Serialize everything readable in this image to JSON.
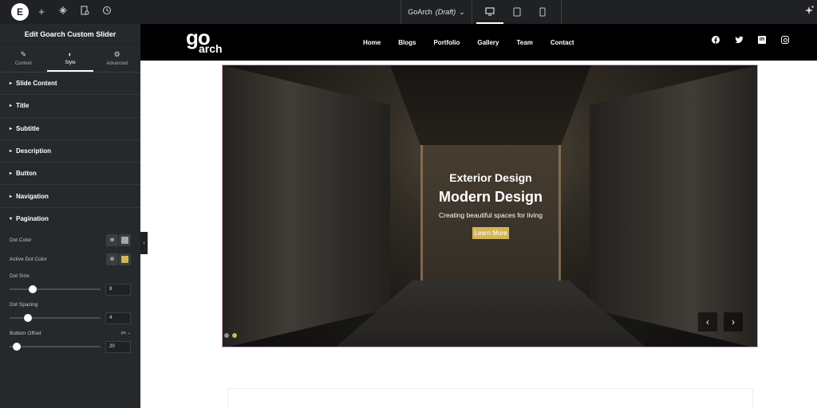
{
  "topbar": {
    "logo_letter": "E",
    "add_icon": "+",
    "doc_name": "GoArch",
    "doc_status": "(Draft)",
    "chevron": "⌄",
    "devices": [
      "desktop-icon",
      "tablet-icon",
      "mobile-icon"
    ]
  },
  "sidebar": {
    "header": "Edit Goarch Custom Slider",
    "tabs": [
      {
        "label": "Content",
        "icon": "✎"
      },
      {
        "label": "Style",
        "icon": "◐"
      },
      {
        "label": "Advanced",
        "icon": "⚙"
      }
    ],
    "sections": [
      "Slide Content",
      "Title",
      "Subtitle",
      "Description",
      "Button",
      "Navigation",
      "Pagination"
    ],
    "caret_collapsed": "▸",
    "caret_open": "▾",
    "dot_color_label": "Dot Color",
    "active_dot_color_label": "Active Dot Color",
    "dot_size_label": "Dot Size",
    "dot_size_value": "8",
    "dot_size_fraction": 0.25,
    "dot_spacing_label": "Dot Spacing",
    "dot_spacing_value": "4",
    "dot_spacing_fraction": 0.2,
    "bottom_offset_label": "Bottom Offset",
    "bottom_offset_unit": "px ⌄",
    "bottom_offset_value": "20",
    "bottom_offset_fraction": 0.08,
    "globe_icon": "⊕",
    "collapse_icon": "‹"
  },
  "site": {
    "brand_top": "go",
    "brand_bottom": "arch",
    "nav": [
      "Home",
      "Blogs",
      "Portfolio",
      "Gallery",
      "Team",
      "Contact"
    ],
    "social": [
      "facebook-icon",
      "twitter-icon",
      "linkedin-icon",
      "instagram-icon"
    ],
    "linkedin_text": "in"
  },
  "slide": {
    "title": "Exterior Design",
    "subtitle": "Modern Design",
    "description": "Creating beautiful spaces for living",
    "button": "Learn More",
    "prev": "‹",
    "next": "›",
    "dot_count": 2,
    "active_dot": 1
  },
  "colors": {
    "accent_gold": "#d4b556",
    "panel_bg": "#26292c",
    "topbar_bg": "#1f2124"
  }
}
